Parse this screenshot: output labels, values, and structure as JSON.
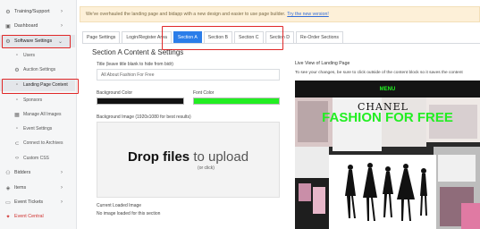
{
  "sidebar": {
    "items": [
      {
        "label": "Training/Support",
        "icon": "gear-icon",
        "has_chevron": true
      },
      {
        "label": "Dashboard",
        "icon": "dashboard-icon",
        "has_chevron": true
      },
      {
        "label": "Software Settings",
        "icon": "settings-icon",
        "has_chevron": true
      },
      {
        "label": "Users",
        "icon": "document-icon"
      },
      {
        "label": "Auction Settings",
        "icon": "settings-icon"
      },
      {
        "label": "Landing Page Content",
        "icon": "document-icon"
      },
      {
        "label": "Sponsors",
        "icon": "document-icon"
      },
      {
        "label": "Manage All Images",
        "icon": "image-icon"
      },
      {
        "label": "Event Settings",
        "icon": "document-icon"
      },
      {
        "label": "Connect to Archives",
        "icon": "link-icon"
      },
      {
        "label": "Custom CSS",
        "icon": "code-icon"
      },
      {
        "label": "Bidders",
        "icon": "users-icon",
        "has_chevron": true
      },
      {
        "label": "Items",
        "icon": "tag-icon",
        "has_chevron": true
      },
      {
        "label": "Event Tickets",
        "icon": "ticket-icon",
        "has_chevron": true
      },
      {
        "label": "Event Central",
        "icon": "star-icon"
      }
    ]
  },
  "banner": {
    "text": "We've overhauled the landing page and bidapp with a new design and easier to use page builder.",
    "link": "Try the new version!"
  },
  "tabs": [
    "Page Settings",
    "Login/Register Area",
    "Section A",
    "Section B",
    "Section C",
    "Section D",
    "Re-Order Sections"
  ],
  "active_tab": "Section A",
  "form": {
    "section_title": "Section A Content & Settings",
    "title_label": "Title (leave title blank to hide from bidr)",
    "title_value": "All About Fashion For Free",
    "bg_color_label": "Background Color",
    "bg_color_value": "#111111",
    "font_color_label": "Font Color",
    "font_color_value": "#22ee22",
    "bg_image_label": "Background Image (1920x1080 for best results)",
    "drop_main": "Drop files",
    "drop_main_suffix": "to upload",
    "drop_sub": "(or click)",
    "current_image_label": "Current Loaded Image",
    "current_image_value": "No image loaded for this section"
  },
  "preview": {
    "title": "Live View of Landing Page",
    "note": "To see your changes, be sure to click outside of the content block so it saves the content",
    "menu": "MENU",
    "headline": "FASHION FOR FREE",
    "brand_text": "CHANEL",
    "accent_color": "#22ee22"
  },
  "colors": {
    "highlight": "#e02828",
    "tab_active": "#2b7de9",
    "alert_red": "#d0302e"
  }
}
